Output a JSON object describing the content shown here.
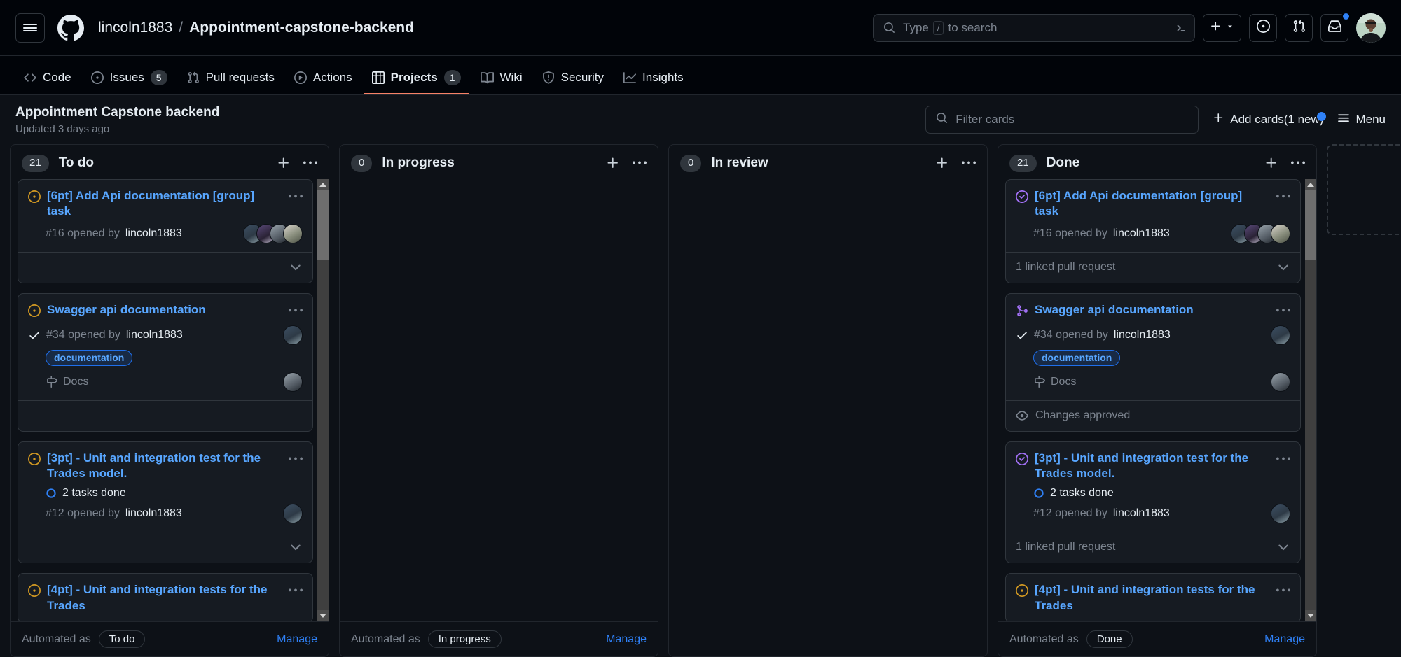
{
  "header": {
    "menu_icon": "hamburger-icon",
    "logo_icon": "github-mark-icon",
    "owner": "lincoln1883",
    "separator": "/",
    "repo": "Appointment-capstone-backend",
    "search": {
      "icon": "search-icon",
      "placeholder": "Type",
      "slash_key": "/",
      "placeholder_tail": "to search",
      "cli_icon": "command-palette-icon"
    },
    "actions": [
      {
        "name": "create-new-button",
        "icon": "plus-icon",
        "caret": "chevron-down-icon"
      },
      {
        "name": "issues-button",
        "icon": "issue-opened-icon"
      },
      {
        "name": "pull-requests-button",
        "icon": "git-pull-request-icon"
      },
      {
        "name": "notifications-button",
        "icon": "inbox-icon",
        "has_dot": true
      },
      {
        "name": "profile-avatar",
        "icon": "avatar-icon"
      }
    ]
  },
  "repo_nav": [
    {
      "label": "Code",
      "icon": "code-icon",
      "count": null,
      "active": false
    },
    {
      "label": "Issues",
      "icon": "issue-opened-icon",
      "count": "5",
      "active": false
    },
    {
      "label": "Pull requests",
      "icon": "git-pull-request-icon",
      "count": null,
      "active": false
    },
    {
      "label": "Actions",
      "icon": "play-icon",
      "count": null,
      "active": false
    },
    {
      "label": "Projects",
      "icon": "table-icon",
      "count": "1",
      "active": true
    },
    {
      "label": "Wiki",
      "icon": "book-icon",
      "count": null,
      "active": false
    },
    {
      "label": "Security",
      "icon": "shield-icon",
      "count": null,
      "active": false
    },
    {
      "label": "Insights",
      "icon": "graph-icon",
      "count": null,
      "active": false
    }
  ],
  "project": {
    "title": "Appointment Capstone backend",
    "updated": "Updated 3 days ago",
    "filter_placeholder": "Filter cards",
    "filter_value": "",
    "filter_icon": "search-icon",
    "add_cards_label": "Add cards(1 new)",
    "add_cards_icon": "plus-icon",
    "menu_label": "Menu",
    "menu_icon": "hamburger-icon"
  },
  "colors": {
    "accent_blue": "#58a6ff",
    "link_blue": "#2f81f7",
    "issue_open_orange": "#d29922",
    "issue_closed_purple": "#a371f7",
    "pr_merged_purple": "#a371f7",
    "tab_underline": "#f78166",
    "bg": "#0d1117",
    "bg_header": "#010409",
    "card_bg": "#161b22",
    "border": "#30363d"
  },
  "columns": [
    {
      "name": "To do",
      "count": "21",
      "add_icon": "plus-icon",
      "menu_icon": "kebab-horizontal-icon",
      "automated_prefix": "Automated as",
      "automated_value": "To do",
      "manage_label": "Manage",
      "has_scrollbar": true,
      "cards": [
        {
          "icon": "issue-opened-icon",
          "icon_color": "#d29922",
          "title": "[6pt] Add Api documentation [group] task",
          "meta": "#16 opened by",
          "author": "lincoln1883",
          "check": false,
          "labels": [],
          "milestone": null,
          "tasks": null,
          "avatars": 4,
          "footer_text": "",
          "footer_icon": null,
          "has_footer": true,
          "has_chevron": true
        },
        {
          "icon": "issue-opened-icon",
          "icon_color": "#d29922",
          "title": "Swagger api documentation",
          "meta": "#34 opened by",
          "author": "lincoln1883",
          "check": true,
          "labels": [
            "documentation"
          ],
          "milestone": "Docs",
          "milestone_icon": "milestone-icon",
          "tasks": null,
          "avatars": 1,
          "footer_text": "",
          "footer_icon": null,
          "has_footer": true,
          "has_chevron": false
        },
        {
          "icon": "issue-opened-icon",
          "icon_color": "#d29922",
          "title": "[3pt] - Unit and integration test for the Trades model.",
          "meta": "#12 opened by",
          "author": "lincoln1883",
          "check": false,
          "labels": [],
          "milestone": null,
          "tasks": "2 tasks done",
          "tasks_icon": "tasklist-icon",
          "avatars": 1,
          "footer_text": "",
          "footer_icon": null,
          "has_footer": true,
          "has_chevron": true
        },
        {
          "icon": "issue-opened-icon",
          "icon_color": "#d29922",
          "title": "[4pt] - Unit and integration tests for the Trades",
          "meta": "",
          "author": "",
          "check": false,
          "labels": [],
          "milestone": null,
          "tasks": null,
          "avatars": 0,
          "footer_text": "",
          "footer_icon": null,
          "has_footer": false,
          "has_chevron": false,
          "partial": true
        }
      ]
    },
    {
      "name": "In progress",
      "count": "0",
      "add_icon": "plus-icon",
      "menu_icon": "kebab-horizontal-icon",
      "automated_prefix": "Automated as",
      "automated_value": "In progress",
      "manage_label": "Manage",
      "has_scrollbar": false,
      "cards": []
    },
    {
      "name": "In review",
      "count": "0",
      "add_icon": "plus-icon",
      "menu_icon": "kebab-horizontal-icon",
      "automated_prefix": "",
      "automated_value": "",
      "manage_label": "",
      "has_scrollbar": false,
      "cards": []
    },
    {
      "name": "Done",
      "count": "21",
      "add_icon": "plus-icon",
      "menu_icon": "kebab-horizontal-icon",
      "automated_prefix": "Automated as",
      "automated_value": "Done",
      "manage_label": "Manage",
      "has_scrollbar": true,
      "cards": [
        {
          "icon": "issue-closed-icon",
          "icon_color": "#a371f7",
          "title": "[6pt] Add Api documentation [group] task",
          "meta": "#16 opened by",
          "author": "lincoln1883",
          "check": false,
          "labels": [],
          "milestone": null,
          "tasks": null,
          "avatars": 4,
          "footer_text": "1 linked pull request",
          "footer_icon": null,
          "has_footer": true,
          "has_chevron": true
        },
        {
          "icon": "git-merge-icon",
          "icon_color": "#a371f7",
          "title": "Swagger api documentation",
          "meta": "#34 opened by",
          "author": "lincoln1883",
          "check": true,
          "labels": [
            "documentation"
          ],
          "milestone": "Docs",
          "milestone_icon": "milestone-icon",
          "tasks": null,
          "avatars": 1,
          "footer_text": "Changes approved",
          "footer_icon": "eye-icon",
          "has_footer": true,
          "has_chevron": false
        },
        {
          "icon": "issue-closed-icon",
          "icon_color": "#a371f7",
          "title": "[3pt] - Unit and integration test for the Trades model.",
          "meta": "#12 opened by",
          "author": "lincoln1883",
          "check": false,
          "labels": [],
          "milestone": null,
          "tasks": "2 tasks done",
          "tasks_icon": "tasklist-icon",
          "avatars": 1,
          "footer_text": "1 linked pull request",
          "footer_icon": null,
          "has_footer": true,
          "has_chevron": true
        },
        {
          "icon": "issue-opened-icon",
          "icon_color": "#d29922",
          "title": "[4pt] - Unit and integration tests for the Trades",
          "meta": "",
          "author": "",
          "check": false,
          "labels": [],
          "milestone": null,
          "tasks": null,
          "avatars": 0,
          "footer_text": "",
          "footer_icon": null,
          "has_footer": false,
          "has_chevron": false,
          "partial": true
        }
      ]
    }
  ],
  "add_column": {
    "name": "add-column-placeholder"
  }
}
